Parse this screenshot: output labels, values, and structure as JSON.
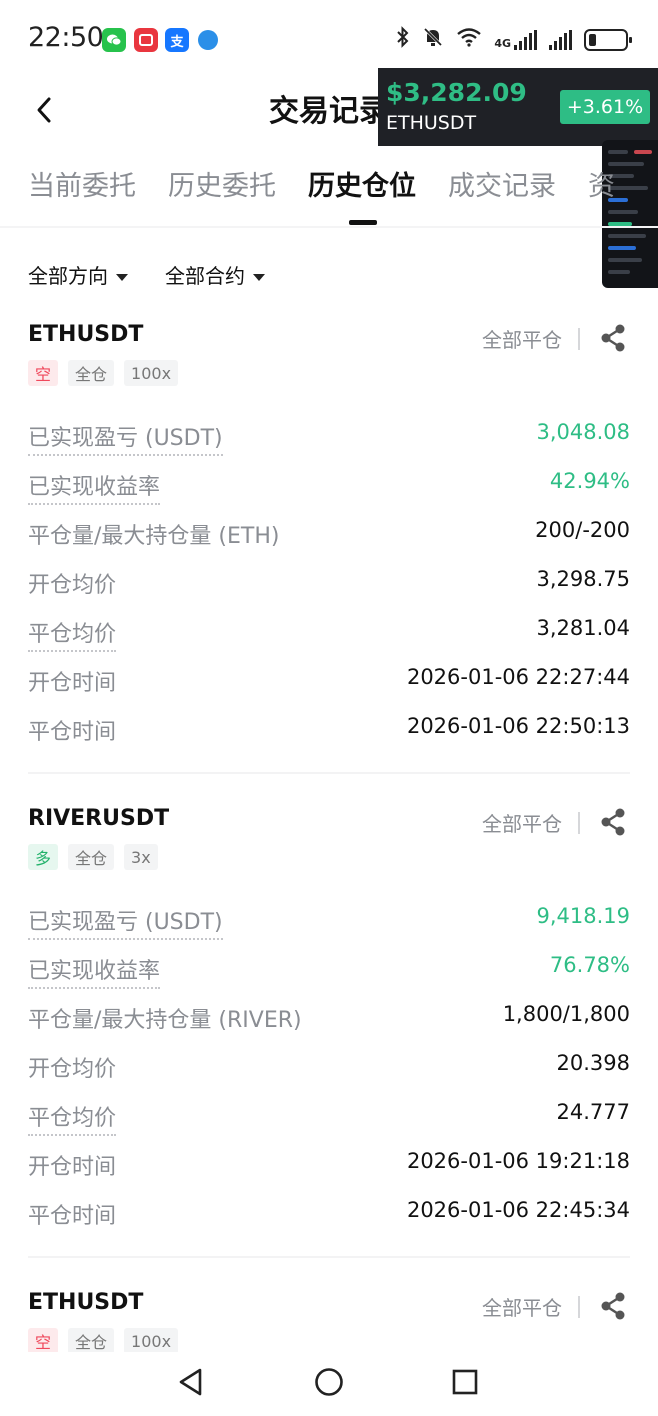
{
  "status_bar": {
    "time": "22:50",
    "app_icons": [
      "wechat-icon",
      "red-app-icon",
      "alipay-icon",
      "browser-icon"
    ],
    "alipay_glyph": "支",
    "network_label": "4G",
    "icons": [
      "bluetooth-icon",
      "mute-bell-icon",
      "wifi-icon",
      "cellular-signal-icon",
      "battery-icon"
    ],
    "battery_level": 0.2
  },
  "header": {
    "title": "交易记录",
    "back_icon": "chevron-left-icon"
  },
  "ticker": {
    "price": "$3,282.09",
    "symbol": "ETHUSDT",
    "change": "+3.61%",
    "change_color": "#2ebd85"
  },
  "tabs": [
    {
      "label": "当前委托",
      "active": false
    },
    {
      "label": "历史委托",
      "active": false
    },
    {
      "label": "历史仓位",
      "active": true
    },
    {
      "label": "成交记录",
      "active": false
    },
    {
      "label": "资",
      "active": false
    }
  ],
  "filters": {
    "direction": "全部方向",
    "contract": "全部合约"
  },
  "colors": {
    "profit_green": "#2ebd85",
    "short_red": "#f0485c",
    "muted_text": "#8a8d93"
  },
  "positions": [
    {
      "symbol": "ETHUSDT",
      "close_all": "全部平仓",
      "tags": {
        "side": "空",
        "margin_mode": "全仓",
        "leverage": "100x"
      },
      "rows": {
        "realized_pnl": {
          "label": "已实现盈亏 (USDT)",
          "value": "3,048.08"
        },
        "realized_rate": {
          "label": "已实现收益率",
          "value": "42.94%"
        },
        "close_max_qty": {
          "label": "平仓量/最大持仓量 (ETH)",
          "value": "200/-200"
        },
        "open_avg": {
          "label": "开仓均价",
          "value": "3,298.75"
        },
        "close_avg": {
          "label": "平仓均价",
          "value": "3,281.04"
        },
        "open_time": {
          "label": "开仓时间",
          "value": "2026-01-06 22:27:44"
        },
        "close_time": {
          "label": "平仓时间",
          "value": "2026-01-06 22:50:13"
        }
      }
    },
    {
      "symbol": "RIVERUSDT",
      "close_all": "全部平仓",
      "tags": {
        "side": "多",
        "margin_mode": "全仓",
        "leverage": "3x"
      },
      "rows": {
        "realized_pnl": {
          "label": "已实现盈亏 (USDT)",
          "value": "9,418.19"
        },
        "realized_rate": {
          "label": "已实现收益率",
          "value": "76.78%"
        },
        "close_max_qty": {
          "label": "平仓量/最大持仓量 (RIVER)",
          "value": "1,800/1,800"
        },
        "open_avg": {
          "label": "开仓均价",
          "value": "20.398"
        },
        "close_avg": {
          "label": "平仓均价",
          "value": "24.777"
        },
        "open_time": {
          "label": "开仓时间",
          "value": "2026-01-06 19:21:18"
        },
        "close_time": {
          "label": "平仓时间",
          "value": "2026-01-06 22:45:34"
        }
      }
    },
    {
      "symbol": "ETHUSDT",
      "close_all": "全部平仓",
      "tags": {
        "side": "空",
        "margin_mode": "全仓",
        "leverage": "100x"
      }
    }
  ],
  "nav_bar": [
    "back-triangle-icon",
    "home-circle-icon",
    "recents-square-icon"
  ]
}
